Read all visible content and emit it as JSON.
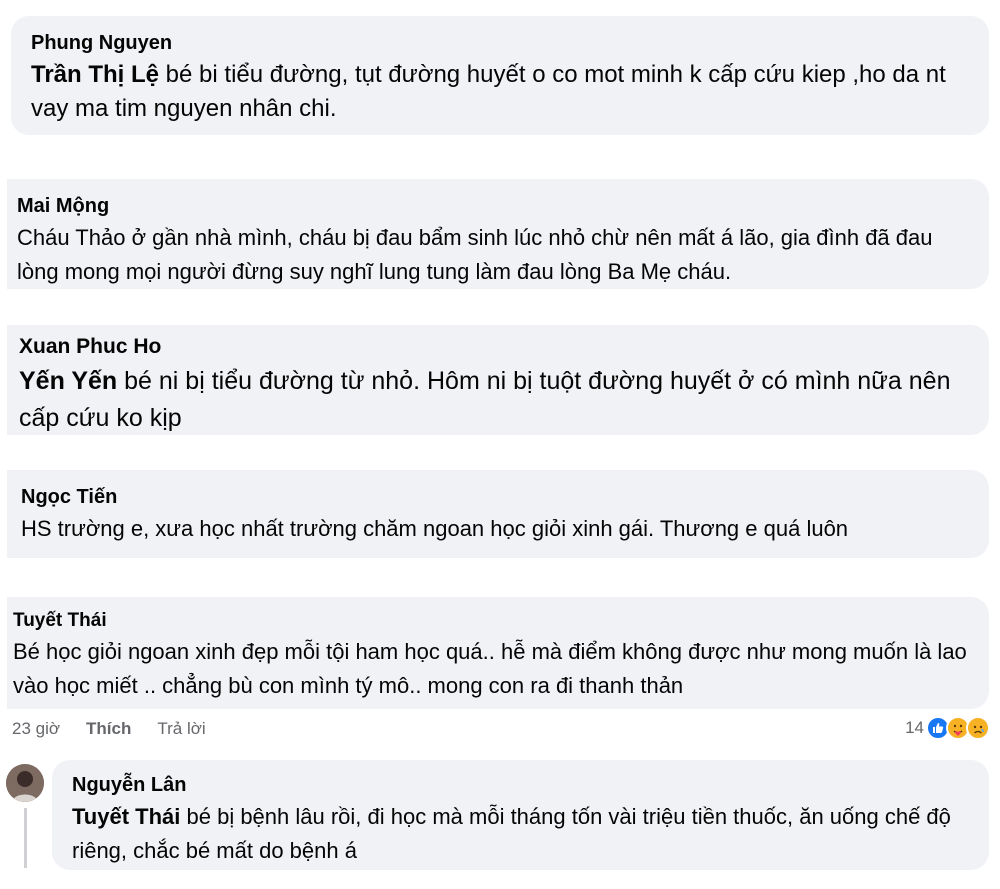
{
  "comments": [
    {
      "author": "Phung Nguyen",
      "mention": "Trần Thị Lệ",
      "text": " bé bi tiểu đường, tụt đường huyết o co mot minh k cấp cứu kiep ,ho da nt vay ma tim nguyen nhân chi."
    },
    {
      "author": "Mai Mộng",
      "mention": "",
      "text": "Cháu Thảo ở gần nhà mình, cháu bị đau bẩm sinh lúc nhỏ chừ nên mất á lão, gia đình đã đau lòng mong mọi người đừng suy nghĩ lung tung làm đau lòng Ba Mẹ cháu."
    },
    {
      "author": "Xuan Phuc Ho",
      "mention": "Yến Yến",
      "text": " bé ni bị tiểu đường từ nhỏ. Hôm ni bị tuột đường huyết ở có mình nữa nên cấp cứu ko kịp"
    },
    {
      "author": "Ngọc Tiến",
      "mention": "",
      "text": "HS trường e, xưa học nhất trường chăm ngoan học giỏi xinh gái. Thương e quá luôn"
    },
    {
      "author": "Tuyết Thái",
      "mention": "",
      "text": "Bé học giỏi ngoan xinh đẹp mỗi tội ham học quá.. hễ mà điểm không được như mong muốn là lao vào học miết .. chẳng bù con mình tý mô.. mong con ra đi thanh thản"
    }
  ],
  "actions": {
    "time": "23 giờ",
    "like": "Thích",
    "reply": "Trả lời",
    "reaction_count": "14"
  },
  "reactions": [
    "like-icon",
    "care-icon",
    "sad-icon"
  ],
  "reply": {
    "author": "Nguyễn Lân",
    "mention": "Tuyết Thái",
    "text": " bé bị bệnh lâu rồi, đi học mà mỗi tháng tốn vài triệu tiền thuốc, ăn uống chế độ riêng, chắc bé mất do bệnh á"
  },
  "colors": {
    "bubble": "#f0f2f5",
    "text": "#050505",
    "meta": "#65676b",
    "like_blue": "#1877f2",
    "reaction_yellow": "#f7b125"
  }
}
